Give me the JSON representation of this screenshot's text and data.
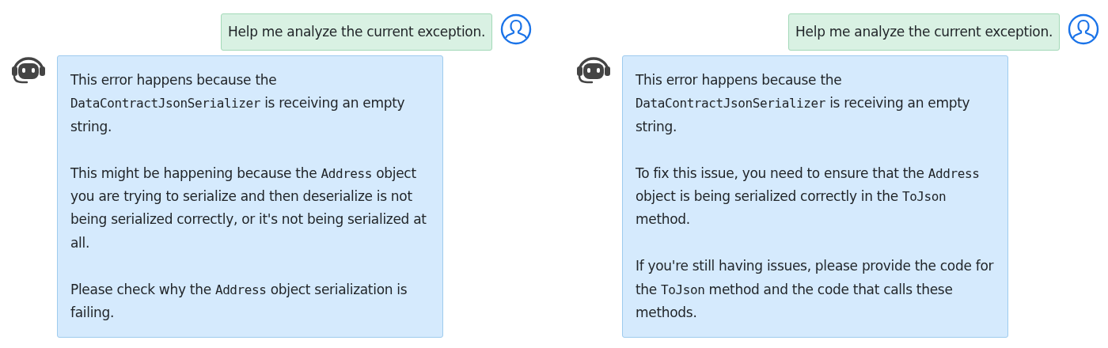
{
  "conversations": [
    {
      "user_message": "Help me analyze the current exception.",
      "reply": [
        [
          {
            "kind": "text",
            "text": "This error happens because the "
          },
          {
            "kind": "code",
            "text": "DataContractJsonSerializer"
          },
          {
            "kind": "text",
            "text": " is receiving an empty string."
          }
        ],
        [
          {
            "kind": "text",
            "text": "This might be happening because the "
          },
          {
            "kind": "code",
            "text": "Address"
          },
          {
            "kind": "text",
            "text": " object you are trying to serialize and then deserialize is not being serialized correctly, or it's not being serialized at all."
          }
        ],
        [
          {
            "kind": "text",
            "text": "Please check why the "
          },
          {
            "kind": "code",
            "text": "Address"
          },
          {
            "kind": "text",
            "text": " object serialization is failing."
          }
        ]
      ]
    },
    {
      "user_message": "Help me analyze the current exception.",
      "reply": [
        [
          {
            "kind": "text",
            "text": "This error happens because the "
          },
          {
            "kind": "code",
            "text": "DataContractJsonSerializer"
          },
          {
            "kind": "text",
            "text": " is receiving an empty string."
          }
        ],
        [
          {
            "kind": "text",
            "text": "To fix this issue, you need to ensure that the "
          },
          {
            "kind": "code",
            "text": "Address"
          },
          {
            "kind": "text",
            "text": " object is being serialized correctly in the "
          },
          {
            "kind": "code",
            "text": "ToJson"
          },
          {
            "kind": "text",
            "text": " method."
          }
        ],
        [
          {
            "kind": "text",
            "text": "If you're still having issues, please provide the code for the "
          },
          {
            "kind": "code",
            "text": "ToJson"
          },
          {
            "kind": "text",
            "text": " method and the code that calls these methods."
          }
        ]
      ]
    }
  ]
}
